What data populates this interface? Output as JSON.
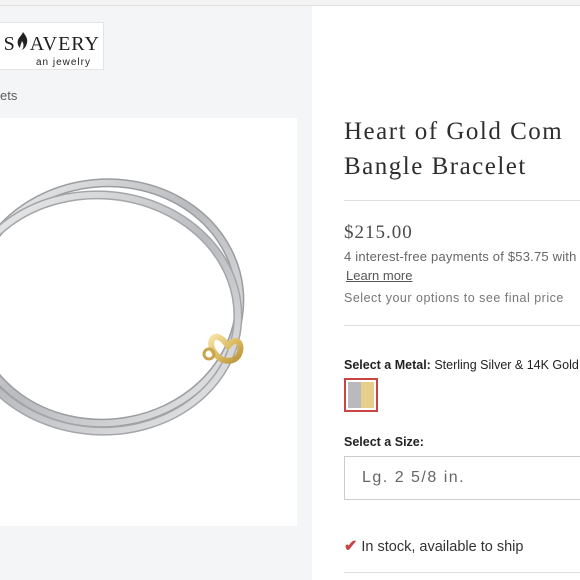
{
  "brand": {
    "logo_top_left": "S",
    "logo_top_right": "AVERY",
    "logo_sub": "an jewelry"
  },
  "breadcrumb": "ets",
  "product": {
    "title_line1": "Heart of Gold Com",
    "title_line2": "Bangle Bracelet",
    "price": "$215.00",
    "installments": "4 interest-free payments of $53.75 with",
    "learn_more": "Learn more",
    "options_note": "Select your options to see final price"
  },
  "metal": {
    "label": "Select a Metal:",
    "selected": "Sterling Silver & 14K Gold",
    "swatch_colors": [
      "#b8babd",
      "#e7cf8b"
    ],
    "accent": "#c74545"
  },
  "size": {
    "label": "Select a Size:",
    "selected": "Lg. 2 5/8 in."
  },
  "stock": {
    "text": "In stock, available to ship",
    "icon": "checkmark-icon"
  }
}
